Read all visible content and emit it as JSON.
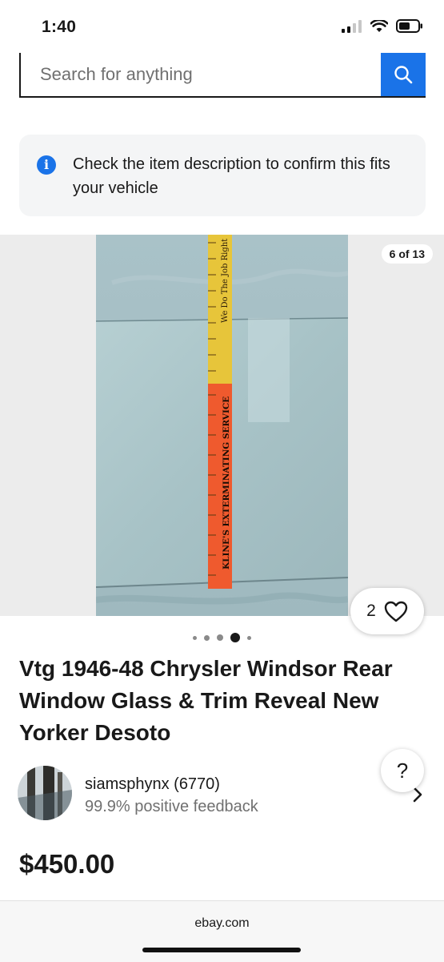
{
  "status_bar": {
    "time": "1:40"
  },
  "search": {
    "placeholder": "Search for anything"
  },
  "notice": {
    "text": "Check the item description to confirm this fits your vehicle"
  },
  "gallery": {
    "counter": "6 of 13",
    "watch_count": "2",
    "current_dot": 4,
    "ruler_text_top": "We Do The Job Right",
    "ruler_text_bottom": "KLINE'S EXTERMINATING SERVICE"
  },
  "listing": {
    "title": "Vtg 1946-48 Chrysler Windsor Rear Window Glass & Trim Reveal New Yorker Desoto",
    "price": "$450.00"
  },
  "seller": {
    "name": "siamsphynx (6770)",
    "feedback": "99.9% positive feedback"
  },
  "help": {
    "label": "?"
  },
  "browser": {
    "url": "ebay.com"
  },
  "colors": {
    "accent": "#1a73e8",
    "text": "#191919",
    "muted": "#707070"
  }
}
